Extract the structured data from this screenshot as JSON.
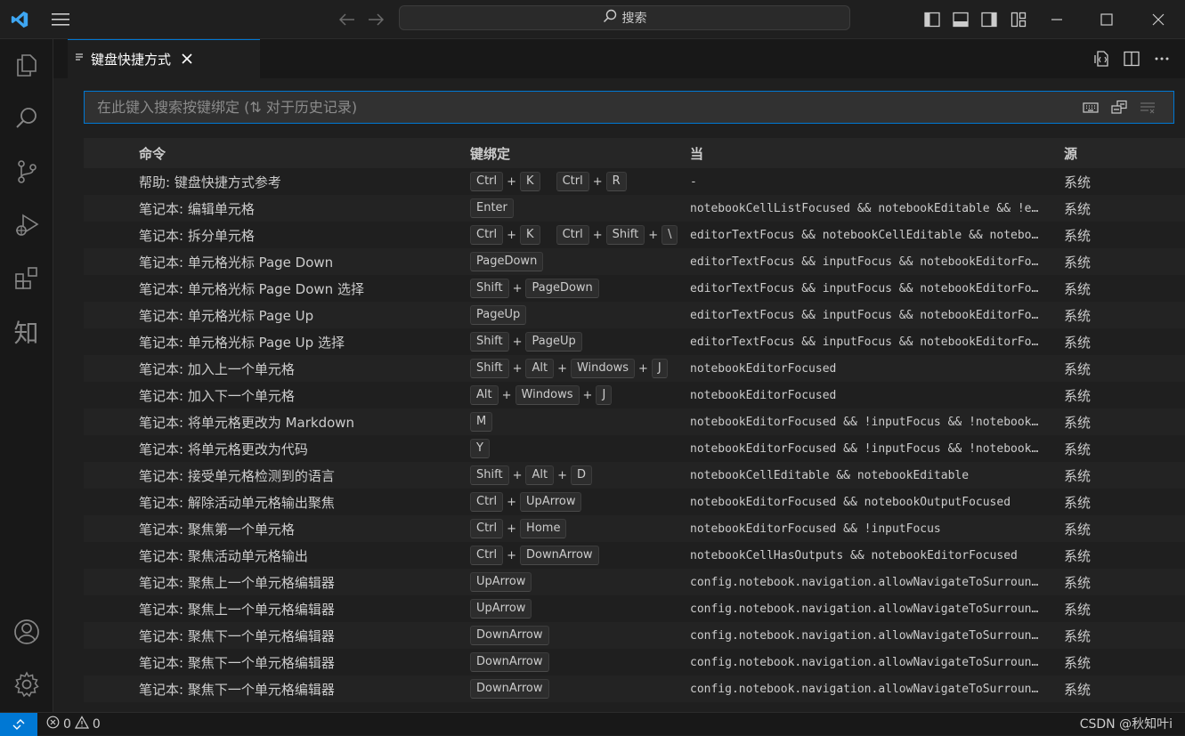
{
  "titlebar": {
    "search_label": "搜索",
    "icons": [
      "vscode-logo-icon",
      "menu-icon",
      "back-arrow-icon",
      "forward-arrow-icon",
      "toggle-sidebar-icon",
      "toggle-panel-icon",
      "toggle-secondary-sidebar-icon",
      "customize-layout-icon",
      "minimize-icon",
      "maximize-icon",
      "close-icon"
    ]
  },
  "activitybar": {
    "items": [
      "explorer-icon",
      "search-icon",
      "source-control-icon",
      "run-debug-icon",
      "extensions-icon",
      "zhi-icon"
    ],
    "zhi_label": "知",
    "bottom": [
      "account-icon",
      "settings-gear-icon"
    ]
  },
  "tab": {
    "label": "键盘快捷方式"
  },
  "kb_search": {
    "placeholder": "在此键入搜索按键绑定 (⇅ 对于历史记录)"
  },
  "table": {
    "headers": {
      "command": "命令",
      "keybinding": "键绑定",
      "when": "当",
      "source": "源"
    },
    "rows": [
      {
        "command": "帮助: 键盘快捷方式参考",
        "keys": [
          [
            "Ctrl",
            "K"
          ],
          [
            "Ctrl",
            "R"
          ]
        ],
        "when": "-",
        "source": "系统"
      },
      {
        "command": "笔记本: 编辑单元格",
        "keys": [
          [
            "Enter"
          ]
        ],
        "when": "notebookCellListFocused && notebookEditable && !e…",
        "source": "系统"
      },
      {
        "command": "笔记本: 拆分单元格",
        "keys": [
          [
            "Ctrl",
            "K"
          ],
          [
            "Ctrl",
            "Shift",
            "\\"
          ]
        ],
        "when": "editorTextFocus && notebookCellEditable && notebo…",
        "source": "系统"
      },
      {
        "command": "笔记本: 单元格光标 Page Down",
        "keys": [
          [
            "PageDown"
          ]
        ],
        "when": "editorTextFocus && inputFocus && notebookEditorFo…",
        "source": "系统"
      },
      {
        "command": "笔记本: 单元格光标 Page Down 选择",
        "keys": [
          [
            "Shift",
            "PageDown"
          ]
        ],
        "when": "editorTextFocus && inputFocus && notebookEditorFo…",
        "source": "系统"
      },
      {
        "command": "笔记本: 单元格光标 Page Up",
        "keys": [
          [
            "PageUp"
          ]
        ],
        "when": "editorTextFocus && inputFocus && notebookEditorFo…",
        "source": "系统"
      },
      {
        "command": "笔记本: 单元格光标 Page Up 选择",
        "keys": [
          [
            "Shift",
            "PageUp"
          ]
        ],
        "when": "editorTextFocus && inputFocus && notebookEditorFo…",
        "source": "系统"
      },
      {
        "command": "笔记本: 加入上一个单元格",
        "keys": [
          [
            "Shift",
            "Alt",
            "Windows",
            "J"
          ]
        ],
        "when": "notebookEditorFocused",
        "source": "系统"
      },
      {
        "command": "笔记本: 加入下一个单元格",
        "keys": [
          [
            "Alt",
            "Windows",
            "J"
          ]
        ],
        "when": "notebookEditorFocused",
        "source": "系统"
      },
      {
        "command": "笔记本: 将单元格更改为 Markdown",
        "keys": [
          [
            "M"
          ]
        ],
        "when": "notebookEditorFocused && !inputFocus && !notebook…",
        "source": "系统"
      },
      {
        "command": "笔记本: 将单元格更改为代码",
        "keys": [
          [
            "Y"
          ]
        ],
        "when": "notebookEditorFocused && !inputFocus && !notebook…",
        "source": "系统"
      },
      {
        "command": "笔记本: 接受单元格检测到的语言",
        "keys": [
          [
            "Shift",
            "Alt",
            "D"
          ]
        ],
        "when": "notebookCellEditable && notebookEditable",
        "source": "系统"
      },
      {
        "command": "笔记本: 解除活动单元格输出聚焦",
        "keys": [
          [
            "Ctrl",
            "UpArrow"
          ]
        ],
        "when": "notebookEditorFocused && notebookOutputFocused",
        "source": "系统"
      },
      {
        "command": "笔记本: 聚焦第一个单元格",
        "keys": [
          [
            "Ctrl",
            "Home"
          ]
        ],
        "when": "notebookEditorFocused && !inputFocus",
        "source": "系统"
      },
      {
        "command": "笔记本: 聚焦活动单元格输出",
        "keys": [
          [
            "Ctrl",
            "DownArrow"
          ]
        ],
        "when": "notebookCellHasOutputs && notebookEditorFocused",
        "source": "系统"
      },
      {
        "command": "笔记本: 聚焦上一个单元格编辑器",
        "keys": [
          [
            "UpArrow"
          ]
        ],
        "when": "config.notebook.navigation.allowNavigateToSurroun…",
        "source": "系统"
      },
      {
        "command": "笔记本: 聚焦上一个单元格编辑器",
        "keys": [
          [
            "UpArrow"
          ]
        ],
        "when": "config.notebook.navigation.allowNavigateToSurroun…",
        "source": "系统"
      },
      {
        "command": "笔记本: 聚焦下一个单元格编辑器",
        "keys": [
          [
            "DownArrow"
          ]
        ],
        "when": "config.notebook.navigation.allowNavigateToSurroun…",
        "source": "系统"
      },
      {
        "command": "笔记本: 聚焦下一个单元格编辑器",
        "keys": [
          [
            "DownArrow"
          ]
        ],
        "when": "config.notebook.navigation.allowNavigateToSurroun…",
        "source": "系统"
      },
      {
        "command": "笔记本: 聚焦下一个单元格编辑器",
        "keys": [
          [
            "DownArrow"
          ]
        ],
        "when": "config.notebook.navigation.allowNavigateToSurroun…",
        "source": "系统"
      }
    ]
  },
  "statusbar": {
    "errors": "0",
    "warnings": "0",
    "watermark": "CSDN @秋知叶i"
  },
  "colors": {
    "accent": "#0078d4",
    "background": "#1f1f1f",
    "sidebar": "#181818"
  }
}
